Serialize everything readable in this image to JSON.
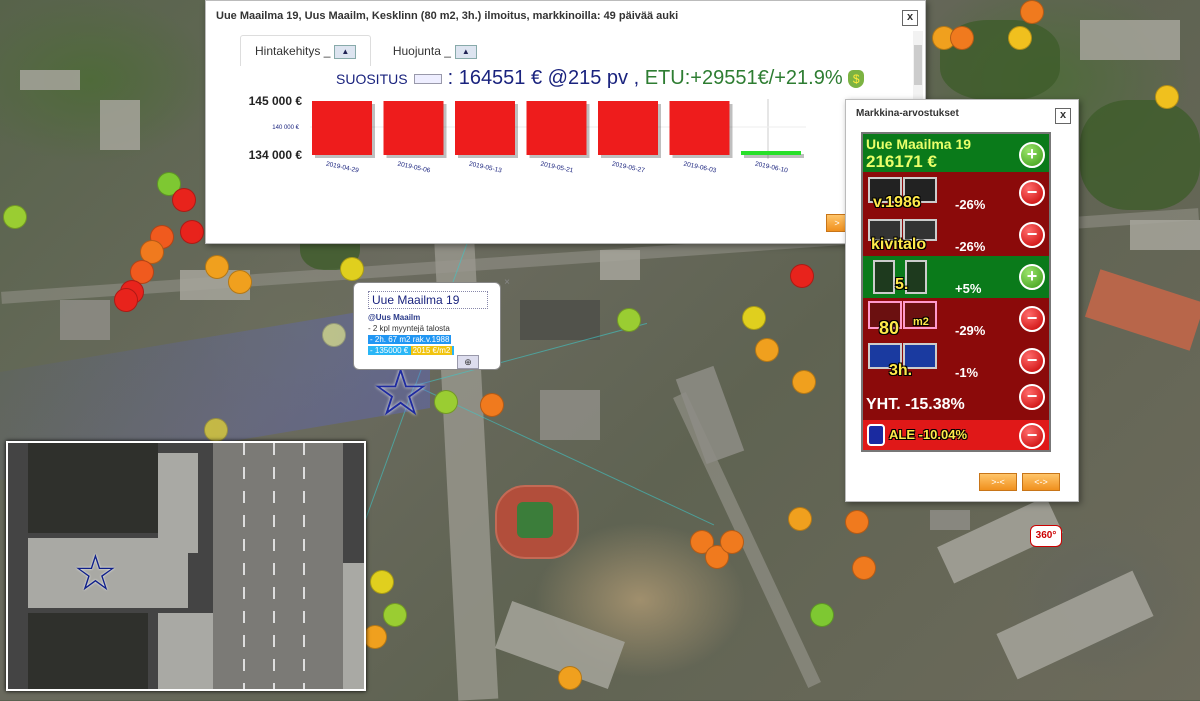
{
  "main_window": {
    "title": "Uue Maailma 19, Uus Maailm, Kesklinn (80 m2, 3h.) ilmoitus, markkinoilla: 49 päivää auki",
    "close": "x",
    "tabs": [
      {
        "label": "Hintakehitys _",
        "active": true
      },
      {
        "label": "Huojunta _",
        "active": false
      }
    ],
    "suggestion": {
      "label": "SUOSITUS",
      "value": ": 164551 € @215 pv",
      "sep": ",",
      "gain": "ETU:+29551€/+21.9%",
      "bag_icon": "money-bag-icon"
    },
    "next_button": ">"
  },
  "chart_data": {
    "type": "bar",
    "categories": [
      "2019-04-29",
      "2019-05-06",
      "2019-05-13",
      "2019-05-21",
      "2019-05-27",
      "2019-06-03",
      "2019-06-10"
    ],
    "values": [
      140000,
      140000,
      140000,
      140000,
      140000,
      140000,
      135000
    ],
    "colors": [
      "#ee1c1c",
      "#ee1c1c",
      "#ee1c1c",
      "#ee1c1c",
      "#ee1c1c",
      "#ee1c1c",
      "#28e02a"
    ],
    "ylim": [
      134000,
      145000
    ],
    "y_ticks": [
      "145 000 €",
      "134 000 €"
    ],
    "annotation": "140 000 €",
    "xlabel": "",
    "ylabel": ""
  },
  "market": {
    "title": "Markkina-arvostukset",
    "close": "x",
    "header": {
      "name": "Uue Maailma 19",
      "value": "216171 €"
    },
    "rows": [
      {
        "label": "v.1986",
        "pct": "-26%",
        "sign": "minus"
      },
      {
        "label": "kivitalo",
        "pct": "-26%",
        "sign": "minus"
      },
      {
        "label": "5.",
        "pct": "+5%",
        "sign": "plus"
      },
      {
        "label": "80",
        "unit": "m2",
        "pct": "-29%",
        "sign": "minus"
      },
      {
        "label": "3h.",
        "pct": "-1%",
        "sign": "minus"
      }
    ],
    "total": "YHT. -15.38%",
    "ale": "ALE -10.04%",
    "nav": [
      ">-<",
      "<->"
    ]
  },
  "tooltip": {
    "title": "Uue Maailma 19",
    "subtitle": "@Uus Maailm",
    "line1": "- 2 kpl myyntejä talosta",
    "line2": "- 2h. 67 m2 rak.v.1988",
    "line3_price": "- 135000 €",
    "line3_sqm": "2015 €/m2",
    "close": "×"
  },
  "map": {
    "badge": "360°"
  }
}
